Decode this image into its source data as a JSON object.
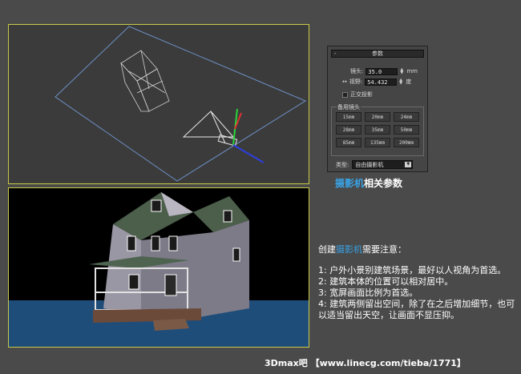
{
  "panel": {
    "rollout_title": "参数",
    "collapse_symbol": "-",
    "lens_label": "镜头:",
    "lens_value": "35.0",
    "lens_unit": "mm",
    "fov_label": "视野:",
    "fov_value": "54.432",
    "fov_unit": "度",
    "ortho_label": "正交投影",
    "stock_lenses_title": "备用镜头",
    "lenses": [
      "15mm",
      "20mm",
      "24mm",
      "28mm",
      "35mm",
      "50mm",
      "85mm",
      "135mm",
      "200mm"
    ],
    "type_label": "类型:",
    "type_value": "自由摄影机"
  },
  "caption": {
    "accent": "摄影机",
    "rest": "相关参数"
  },
  "notes": {
    "title_prefix": "创建",
    "title_accent": "摄影机",
    "title_suffix": "需要注意：",
    "items": [
      "1: 户外小景别建筑场景，最好以人视角为首选。",
      "2: 建筑本体的位置可以相对居中。",
      "3: 宽屏画面比例为首选。",
      "4: 建筑两侧留出空间，除了在之后增加细节，也可以适当留出天空，让画面不显压抑。"
    ]
  },
  "footer": {
    "text": "3Dmax吧 【www.linecg.com/tieba/1771】"
  },
  "colors": {
    "accent": "#39a3e6",
    "viewport_border": "#c9c948"
  }
}
